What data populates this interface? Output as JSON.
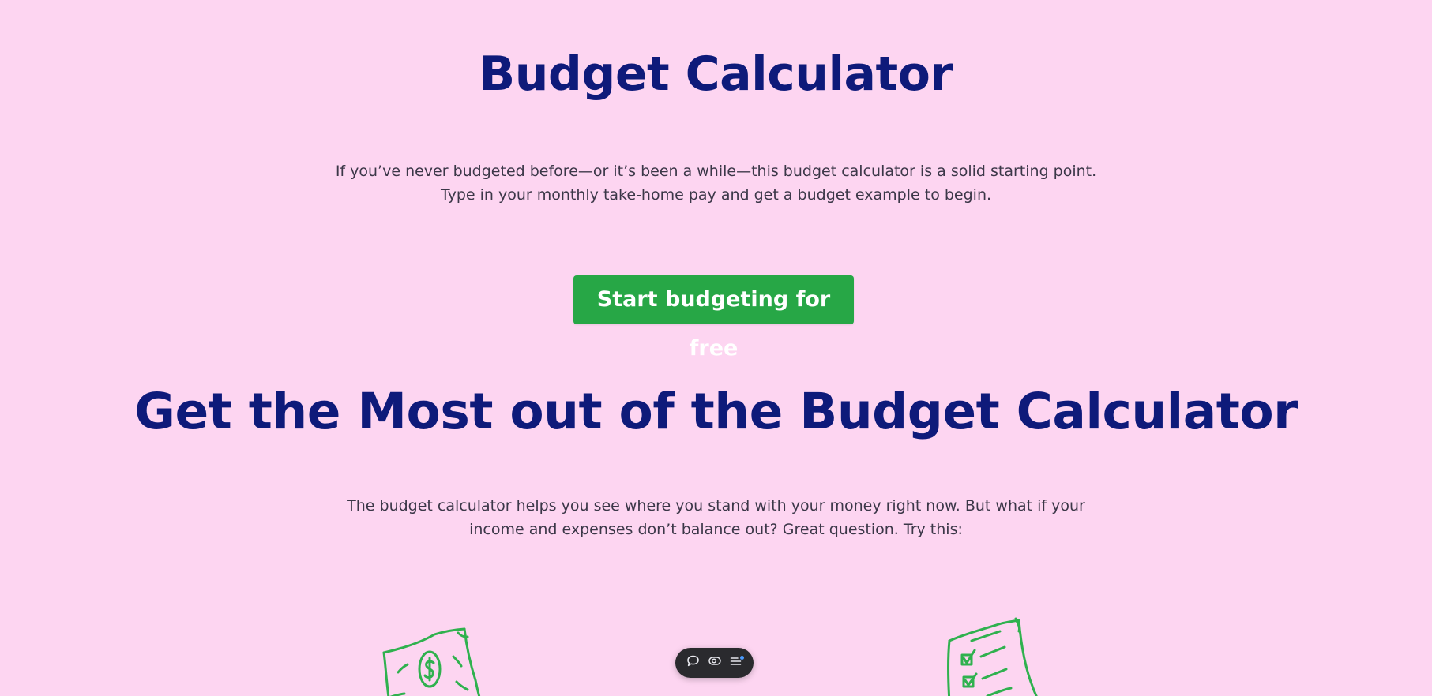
{
  "hero": {
    "title": "Budget Calculator",
    "intro_line_1": "If you’ve never budgeted before—or it’s been a while—this budget calculator is a solid starting point.",
    "intro_line_2": "Type in your monthly take-home pay and get a budget example to begin.",
    "cta_label": "Start budgeting for free"
  },
  "section": {
    "title": "Get the Most out of the Budget Calculator",
    "intro_line_1": "The budget calculator helps you see where you stand with your money right now. But what if your",
    "intro_line_2": "income and expenses don’t balance out? Great question. Try this:"
  },
  "illustrations": {
    "left_icon": "money-bill-icon",
    "right_icon": "checklist-icon"
  },
  "toolbar": {
    "icons": [
      "comment-icon",
      "view-toggle-icon",
      "menu-icon"
    ]
  },
  "colors": {
    "background": "#fdd5f1",
    "heading": "#0e1a7a",
    "body_text": "#3b3748",
    "cta": "#27a746",
    "illustration": "#2fb14e",
    "toolbar": "#2a2a2e",
    "notification_dot": "#4a9bff"
  }
}
